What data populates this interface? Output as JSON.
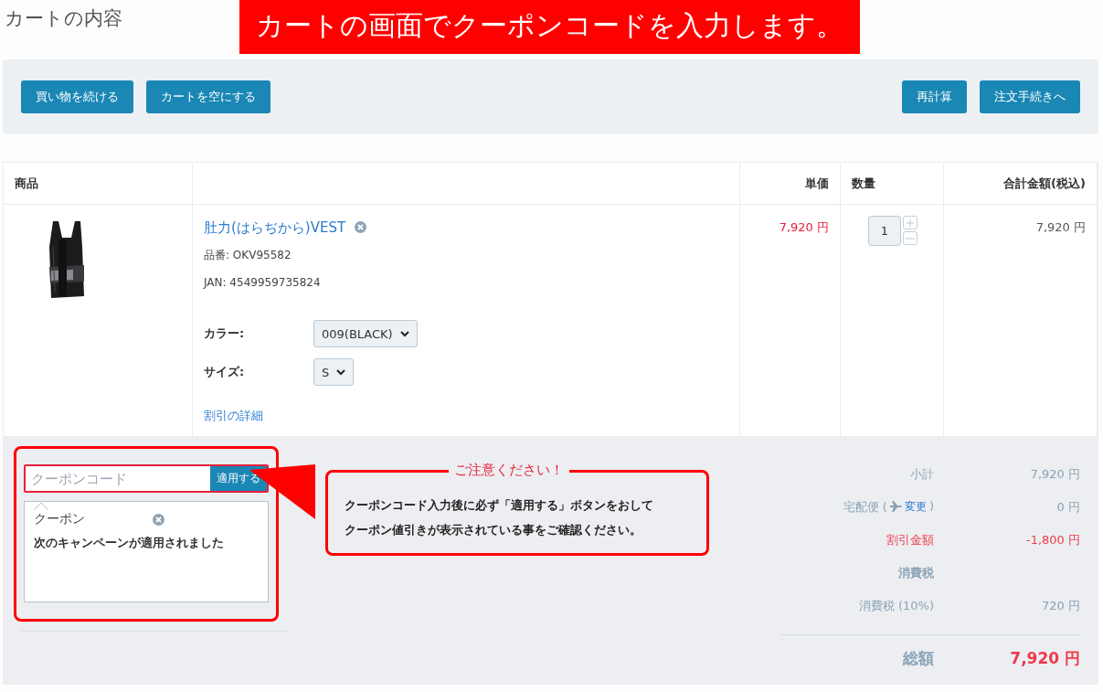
{
  "page_title": "カートの内容",
  "banner": "カートの画面でクーポンコードを入力します。",
  "toolbar": {
    "left_buttons": [
      "買い物を続ける",
      "カートを空にする"
    ],
    "right_buttons": [
      "再計算",
      "注文手続きへ"
    ]
  },
  "table": {
    "columns": [
      "商品",
      "単価",
      "数量",
      "合計金額(税込)"
    ],
    "rows": [
      {
        "name": "肚力(はらぢから)VEST",
        "sku": "品番: OKV95582",
        "jan": "JAN: 4549959735824",
        "options": [
          {
            "label": "カラー:",
            "value": "009(BLACK)"
          },
          {
            "label": "サイズ:",
            "value": "S"
          }
        ],
        "discount_link": "割引の詳細",
        "unit_price": "7,920 円",
        "quantity": "1",
        "total": "7,920 円"
      }
    ]
  },
  "coupon": {
    "placeholder": "クーポンコード",
    "apply_button": "適用する",
    "result_title": "クーポン",
    "result_message": "次のキャンペーンが適用されました"
  },
  "notice": {
    "title": "ご注意ください！",
    "lines": [
      "クーポンコード入力後に必ず「適用する」ボタンをおして",
      "クーポン値引きが表示されている事をご確認ください。"
    ]
  },
  "summary": {
    "rows": [
      {
        "kind": "plain",
        "label": "小計",
        "value": "7,920 円"
      },
      {
        "kind": "shipping",
        "label": "宅配便 (",
        "link": "変更",
        "label_end": ")",
        "value": "0 円"
      },
      {
        "kind": "discount",
        "label": "割引金額",
        "value": "-1,800 円"
      },
      {
        "kind": "heading",
        "label": "消費税"
      },
      {
        "kind": "plain",
        "label": "消費税 (10%)",
        "value": "720 円"
      }
    ],
    "total_label": "総額",
    "total_value": "7,920 円"
  }
}
